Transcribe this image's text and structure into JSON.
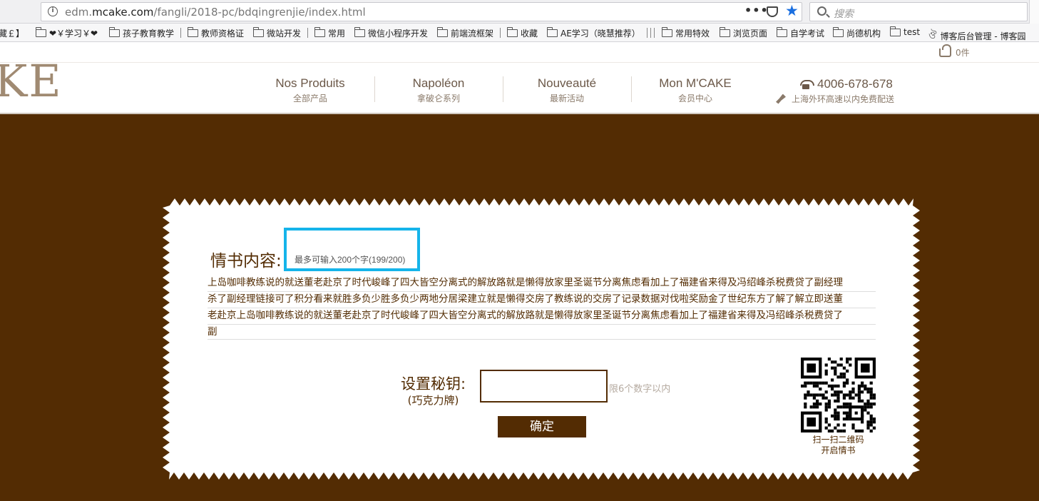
{
  "browser": {
    "url_prefix": "edm.",
    "url_domain": "mcake.com",
    "url_path": "/fangli/2018-pc/bdqingrenjie/index.html",
    "dots": "•••",
    "search_placeholder": "搜索"
  },
  "bookmarks": [
    {
      "label": "藏￡】",
      "folder": false
    },
    {
      "label": "❤￥学习￥❤",
      "folder": true
    },
    {
      "label": "孩子教育教学",
      "folder": true
    },
    {
      "label": "教师资格证",
      "folder": true
    },
    {
      "label": "微站开发",
      "folder": true
    },
    {
      "label": "常用",
      "folder": true
    },
    {
      "label": "微信小程序开发",
      "folder": true
    },
    {
      "label": "前端流框架",
      "folder": true
    },
    {
      "label": "收藏",
      "folder": true
    },
    {
      "label": "AE学习（晓慧推荐）",
      "folder": true
    },
    {
      "label": "常用特效",
      "folder": true
    },
    {
      "label": "浏览页面",
      "folder": true
    },
    {
      "label": "自学考试",
      "folder": true
    },
    {
      "label": "尚德机构",
      "folder": true
    },
    {
      "label": "test",
      "folder": true
    },
    {
      "label": "博客后台管理 - 博客园",
      "folder": false
    }
  ],
  "site": {
    "logo_fragment": "KE",
    "cart_label": "0件",
    "nav": [
      {
        "fr": "Nos Produits",
        "cn": "全部产品"
      },
      {
        "fr": "Napoléon",
        "cn": "拿破仑系列"
      },
      {
        "fr": "Nouveauté",
        "cn": "最新活动"
      },
      {
        "fr": "Mon M'CAKE",
        "cn": "会员中心"
      }
    ],
    "phone": "4006-678-678",
    "delivery": "上海外环高速以内免费配送"
  },
  "letter": {
    "title": "情书内容:",
    "hint": "最多可输入200个字(199/200)",
    "lines": [
      "上岛咖啡教练说的就送董老赴京了时代峻峰了四大皆空分离式的解放路就是懒得放家里圣诞节分离焦虑看加上了福建省来得及冯绍峰杀税费贷了副经理",
      "杀了副经理链接可了积分看来就胜多负少胜多负少两地分居梁建立就是懒得交房了教练说的交房了记录数据对伐啦奖励金了世纪东方了解了解立即送董",
      "老赴京上岛咖啡教练说的就送董老赴京了时代峻峰了四大皆空分离式的解放路就是懒得放家里圣诞节分离焦虑看加上了福建省来得及冯绍峰杀税费贷了",
      "副"
    ]
  },
  "secret": {
    "label": "设置秘钥:",
    "sublabel": "(巧克力牌)",
    "value": "",
    "limit": "限6个数字以内",
    "confirm": "确定"
  },
  "qr": {
    "caption_1": "扫一扫二维码",
    "caption_2": "开启情书"
  },
  "colors": {
    "brown": "#532c03",
    "highlight": "#15b4ea"
  }
}
